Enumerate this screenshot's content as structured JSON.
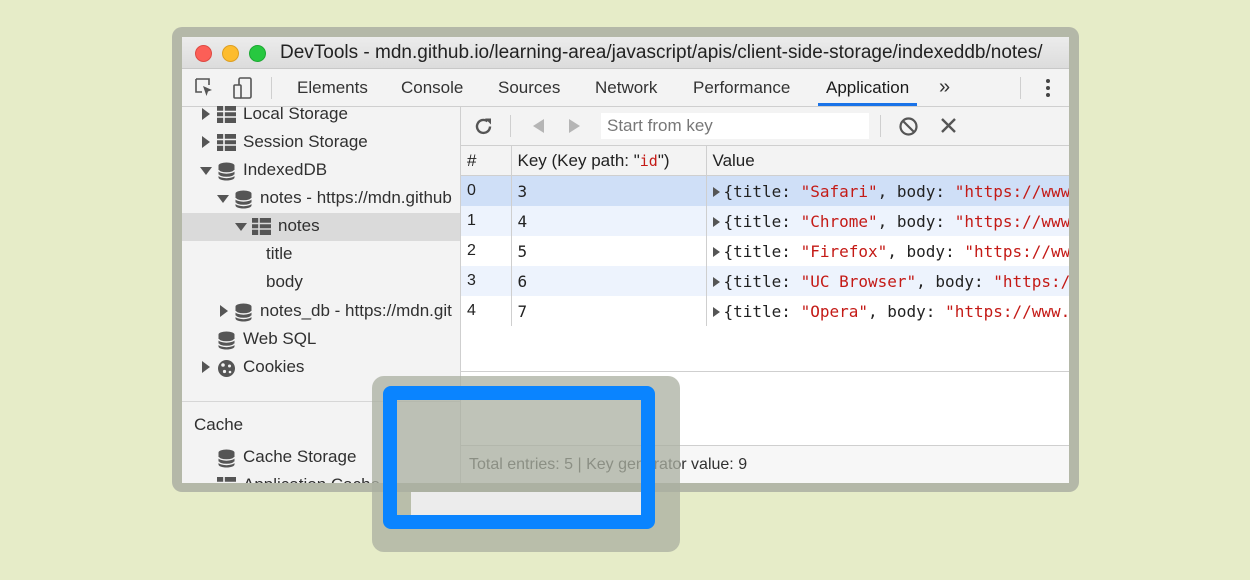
{
  "window": {
    "title": "DevTools - mdn.github.io/learning-area/javascript/apis/client-side-storage/indexeddb/notes/"
  },
  "tabs": [
    {
      "label": "Elements"
    },
    {
      "label": "Console"
    },
    {
      "label": "Sources"
    },
    {
      "label": "Network"
    },
    {
      "label": "Performance"
    },
    {
      "label": "Application"
    }
  ],
  "tabs_more": "»",
  "sidebar": {
    "items": [
      {
        "label": "Local Storage"
      },
      {
        "label": "Session Storage"
      },
      {
        "label": "IndexedDB"
      },
      {
        "label": "notes - https://mdn.github"
      },
      {
        "label": "notes"
      },
      {
        "label": "title"
      },
      {
        "label": "body"
      },
      {
        "label": "notes_db - https://mdn.git"
      },
      {
        "label": "Web SQL"
      },
      {
        "label": "Cookies"
      }
    ],
    "cache_section": "Cache",
    "cache_items": [
      {
        "label": "Cache Storage"
      },
      {
        "label": "Application Cache"
      }
    ]
  },
  "toolbar": {
    "start_placeholder": "Start from key"
  },
  "table": {
    "columns": {
      "num": "#",
      "key_prefix": "Key (Key path: \"",
      "key_path": "id",
      "key_suffix": "\")",
      "value": "Value"
    },
    "rows": [
      {
        "num": "0",
        "key": "3",
        "title": "\"Safari\"",
        "body": "\"https://www"
      },
      {
        "num": "1",
        "key": "4",
        "title": "\"Chrome\"",
        "body": "\"https://www"
      },
      {
        "num": "2",
        "key": "5",
        "title": "\"Firefox\"",
        "body": "\"https://ww"
      },
      {
        "num": "3",
        "key": "6",
        "title": "\"UC Browser\"",
        "body": "\"https:/"
      },
      {
        "num": "4",
        "key": "7",
        "title": "\"Opera\"",
        "body": "\"https://www."
      }
    ],
    "value_open": "{title: ",
    "value_mid": ", body: "
  },
  "footer": {
    "text": "Total entries: 5 | Key generator value: 9"
  },
  "colors": {
    "background": "#e6ecc8",
    "highlight": "#0a84ff",
    "active_tab": "#1a73e8"
  }
}
